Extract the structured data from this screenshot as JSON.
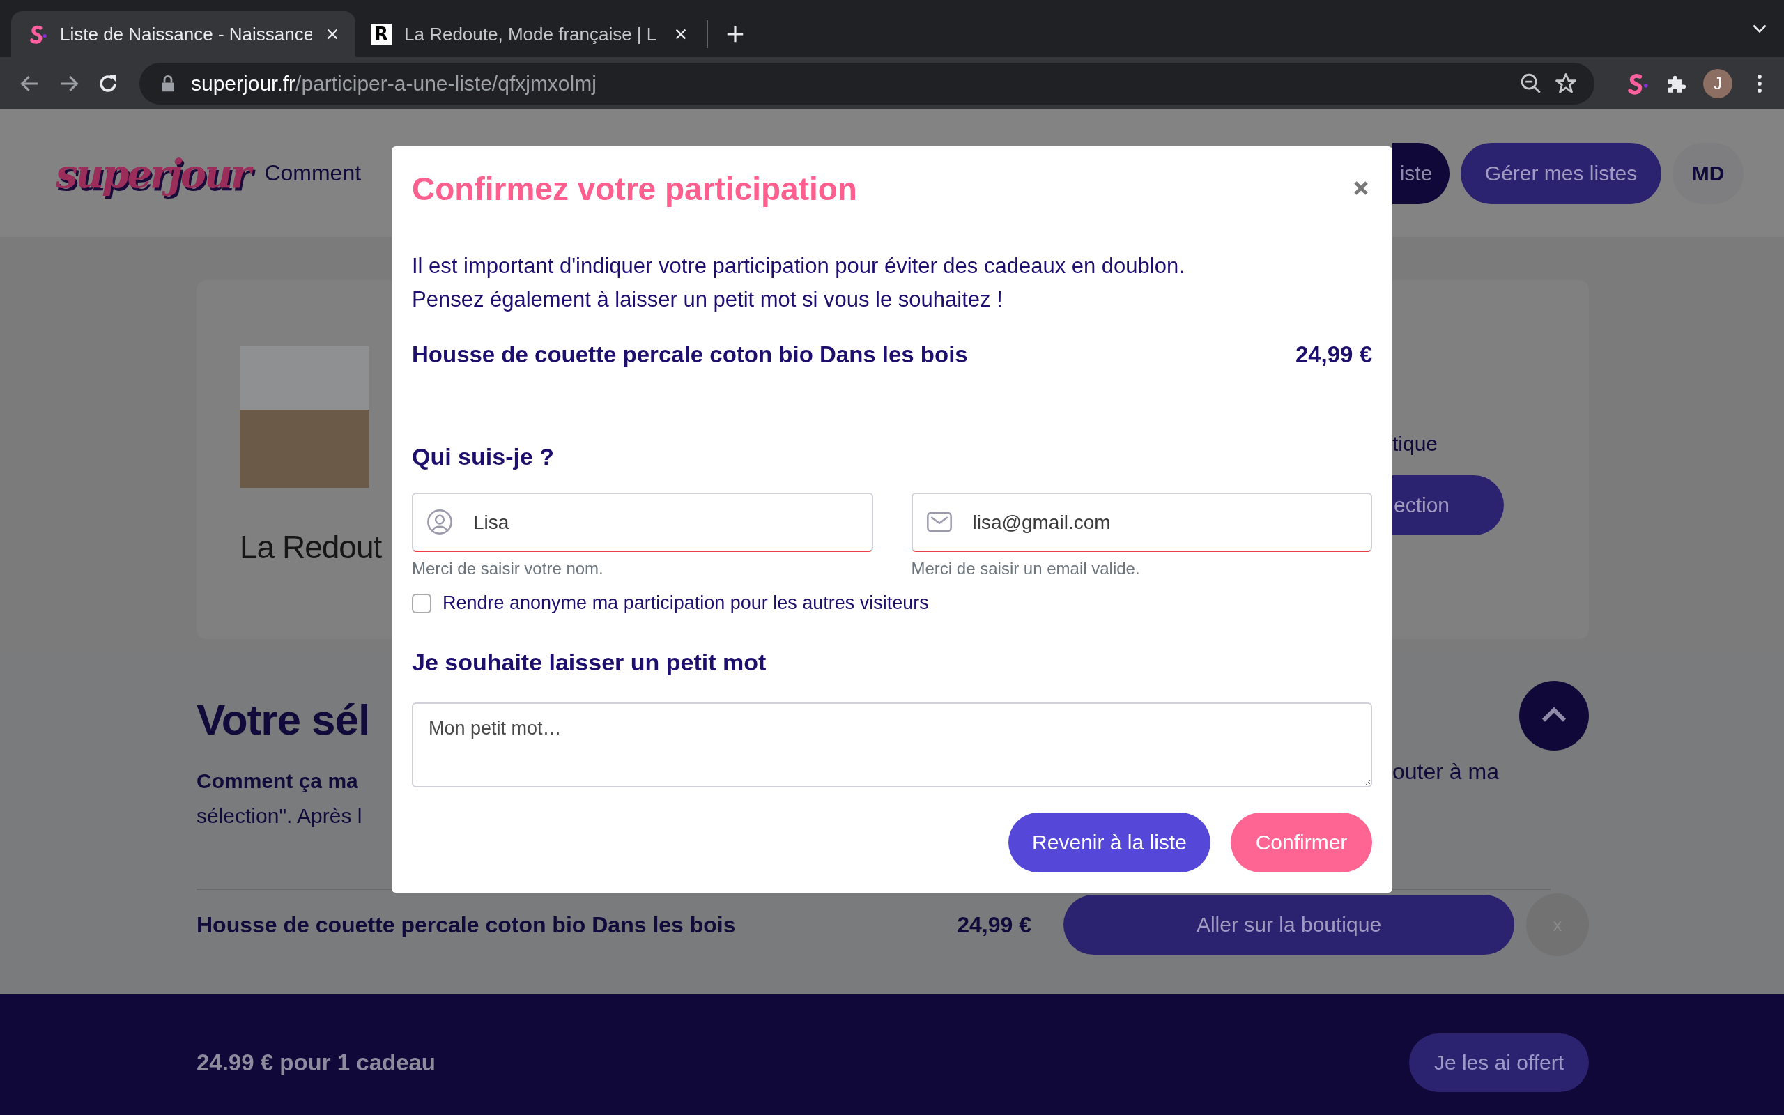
{
  "browser": {
    "tabs": [
      {
        "title": "Liste de Naissance - Naissance",
        "selected": true
      },
      {
        "title": "La Redoute, Mode française | L",
        "favicon_text": "R",
        "selected": false
      }
    ],
    "url_host": "superjour.fr",
    "url_path": "/participer-a-une-liste/qfxjmxolmj",
    "profile_initial": "J"
  },
  "header": {
    "logo": "superjour",
    "nav_link": "Comment",
    "buttons": [
      {
        "label": "iste",
        "kind": "dark"
      },
      {
        "label": "Gérer mes listes",
        "kind": "primary"
      }
    ],
    "avatar": "MD"
  },
  "product_card": {
    "brand": "La Redout",
    "shop_text": "tique",
    "button": "ection"
  },
  "selection": {
    "heading": "Votre sél",
    "intro_bold": "Comment ça ma",
    "intro_line2": "sélection\". Après l",
    "intro_right": "outer à ma",
    "item": {
      "name": "Housse de couette percale coton bio Dans les bois",
      "price": "24,99 €",
      "shop_button": "Aller sur la boutique",
      "remove": "x"
    }
  },
  "footer": {
    "summary": "24.99 € pour 1 cadeau",
    "button": "Je les ai offert"
  },
  "modal": {
    "title": "Confirmez votre participation",
    "intro": "Il est important d'indiquer votre participation pour éviter des cadeaux en doublon.\nPensez également à laisser un petit mot si vous le souhaitez !",
    "product": {
      "name": "Housse de couette percale coton bio Dans les bois",
      "price": "24,99 €"
    },
    "identity_heading": "Qui suis-je ?",
    "fields": [
      {
        "kind": "name",
        "value": "Lisa",
        "hint": "Merci de saisir votre nom.",
        "invalid": true
      },
      {
        "kind": "email",
        "value": "lisa@gmail.com",
        "hint": "Merci de saisir un email valide.",
        "invalid": true
      }
    ],
    "anonymous": {
      "label": "Rendre anonyme ma participation pour les autres visiteurs",
      "checked": false
    },
    "message_heading": "Je souhaite laisser un petit mot",
    "message": {
      "placeholder": "Mon petit mot…"
    },
    "buttons": [
      {
        "label": "Revenir à la liste",
        "kind": "secondary"
      },
      {
        "label": "Confirmer",
        "kind": "primary"
      }
    ]
  }
}
